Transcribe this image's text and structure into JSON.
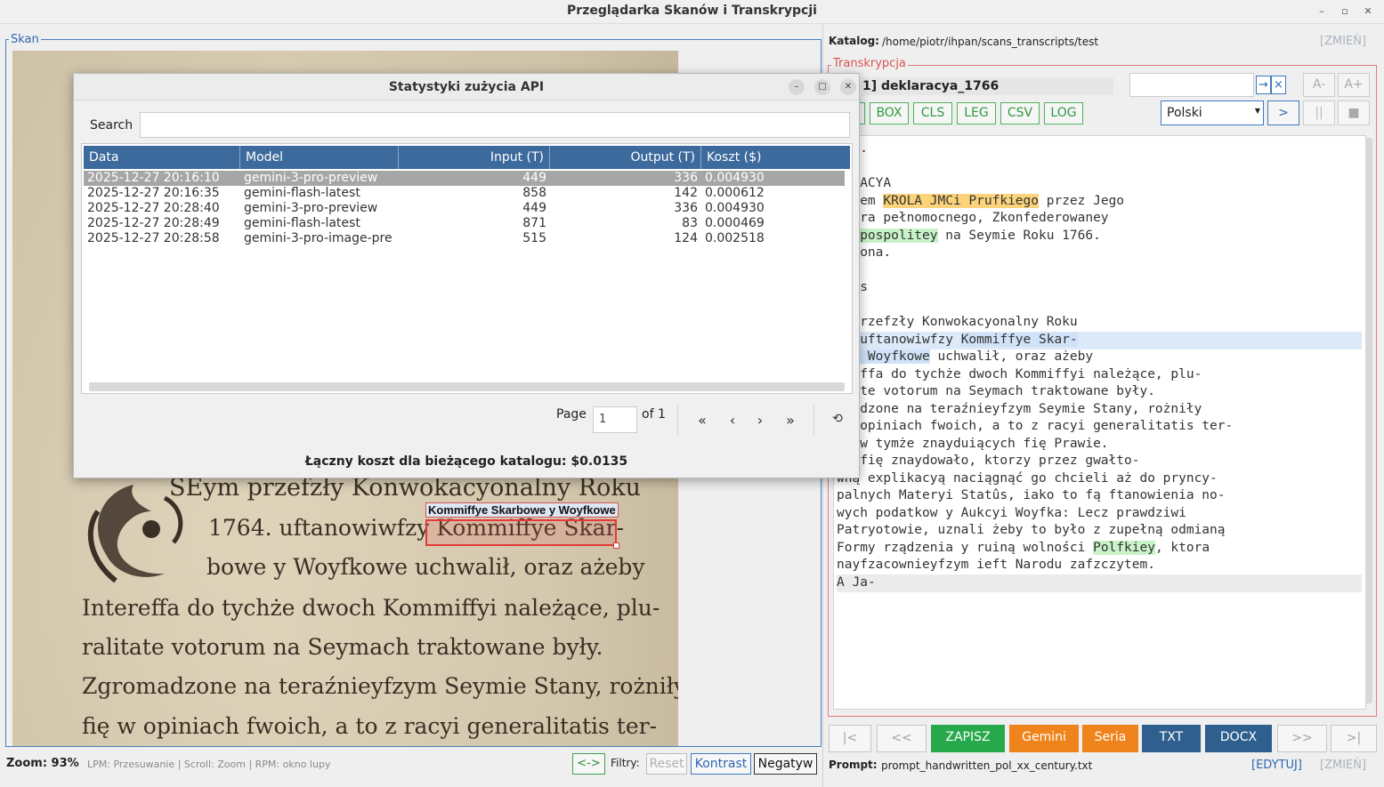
{
  "window": {
    "title": "Przeglądarka Skanów i Transkrypcji"
  },
  "left": {
    "legend": "Skan",
    "scan_lines": [
      "SEym przefzły Konwokacyonalny Roku",
      "1764. uftanowiwfzy Kommiffye Skar-",
      "bowe y Woyfkowe uchwalił, oraz ażeby",
      "Intereffa do tychże dwoch Kommiffyi należące, plu-",
      "ralitate votorum na Seymach traktowane były.",
      "Zgromadzone na teraźnieyfzym Seymie Stany, rożniły",
      "fię w opiniach fwoich, a to z racyi generalitatis ter-"
    ],
    "highlight_label": "Kommiffye Skarbowe y Woyfkowe",
    "zoom": "Zoom: 93%",
    "hint": "LPM: Przesuwanie | Scroll: Zoom | RPM: okno lupy",
    "swap": "<->",
    "filters_label": "Filtry:",
    "reset": "Reset",
    "contrast": "Kontrast",
    "negative": "Negatyw"
  },
  "dialog": {
    "title": "Statystyki zużycia API",
    "search_label": "Search",
    "columns": [
      "Data",
      "Model",
      "Input (T)",
      "Output (T)",
      "Koszt ($)"
    ],
    "rows": [
      {
        "date": "2025-12-27 20:16:10",
        "model": "gemini-3-pro-preview",
        "input": "449",
        "output": "336",
        "cost": "0.004930"
      },
      {
        "date": "2025-12-27 20:16:35",
        "model": "gemini-flash-latest",
        "input": "858",
        "output": "142",
        "cost": "0.000612"
      },
      {
        "date": "2025-12-27 20:28:40",
        "model": "gemini-3-pro-preview",
        "input": "449",
        "output": "336",
        "cost": "0.004930"
      },
      {
        "date": "2025-12-27 20:28:49",
        "model": "gemini-flash-latest",
        "input": "871",
        "output": "83",
        "cost": "0.000469"
      },
      {
        "date": "2025-12-27 20:28:58",
        "model": "gemini-3-pro-image-pre",
        "input": "515",
        "output": "124",
        "cost": "0.002518"
      }
    ],
    "page_label": "Page",
    "page_value": "1",
    "of_label": "of 1",
    "first": "«",
    "prev": "‹",
    "next": "›",
    "last": "»",
    "total": "Łączny koszt dla bieżącego katalogu: $0.0135"
  },
  "right": {
    "katalog_label": "Katalog:",
    "katalog_path": "/home/piotr/ihpan/scans_transcripts/test",
    "change": "[ZMIEŃ]",
    "legend": "Transkrypcja",
    "file_name": "1] deklaracya_1766",
    "find_next": "→",
    "find_clear": "×",
    "font_minus": "A-",
    "font_plus": "A+",
    "tools": [
      "BOX",
      "CLS",
      "LEG",
      "CSV",
      "LOG"
    ],
    "language": "Polski",
    "play": ">",
    "pause": "||",
    "stop": "■",
    "nav_first": "|<",
    "nav_prev": "<<",
    "save": "ZAPISZ",
    "gemini": "Gemini",
    "seria": "Seria",
    "txt": "TXT",
    "docx": "DOCX",
    "nav_next": ">>",
    "nav_last": ">|",
    "prompt_label": "Prompt:",
    "prompt_file": "prompt_handwritten_pol_xx_century.txt",
    "edit": "[EDYTUJ]",
    "change2": "[ZMIEŃ]"
  },
  "transcript": [
    {
      "segs": [
        {
          "t": "195."
        }
      ]
    },
    {
      "segs": [
        {
          "t": ""
        }
      ]
    },
    {
      "segs": [
        {
          "t": "LARACYA"
        }
      ]
    },
    {
      "segs": [
        {
          "t": "eniem "
        },
        {
          "t": "KROLA JMCi Prufkiego",
          "c": "hy"
        },
        {
          "t": " przez Jego"
        }
      ]
    },
    {
      "segs": [
        {
          "t": "iftra pełnomocnego, Zkonfederowaney"
        }
      ]
    },
    {
      "segs": [
        {
          "t": "czypospolitey",
          "c": "hg"
        },
        {
          "t": " na Seymie Roku 1766."
        }
      ]
    },
    {
      "segs": [
        {
          "t": "yniona."
        }
      ]
    },
    {
      "segs": [
        {
          "t": ""
        }
      ]
    },
    {
      "segs": [
        {
          "t": "ri's"
        }
      ]
    },
    {
      "segs": [
        {
          "t": ""
        }
      ]
    },
    {
      "segs": [
        {
          "t": "m przefzły Konwokacyonalny Roku"
        }
      ]
    },
    {
      "segs": [
        {
          "t": "4. uftanowiwfzy "
        },
        {
          "t": "Kommiffye Skar-",
          "c": "hb"
        }
      ]
    },
    {
      "segs": [
        {
          "t": "e y Woyfkowe",
          "c": "hb"
        },
        {
          "t": " uchwalił, oraz ażeby"
        }
      ]
    },
    {
      "segs": [
        {
          "t": "ereffa do tychże dwoch Kommiffyi należące, plu-"
        }
      ]
    },
    {
      "segs": [
        {
          "t": "itate votorum na Seymach traktowane były."
        }
      ]
    },
    {
      "segs": [
        {
          "t": "omadzone na teraźnieyfzym Seymie Stany, rożniły"
        }
      ]
    },
    {
      "segs": [
        {
          "t": " w opiniach fwoich, a to z racyi generalitatis ter-"
        }
      ]
    },
    {
      "segs": [
        {
          "t": "ow w tymże znayduiących fię Prawie."
        }
      ]
    },
    {
      "segs": [
        {
          "t": "lu fię znaydowało, ktorzy przez gwałto-"
        }
      ]
    },
    {
      "segs": [
        {
          "t": "wną explikacyą naciągnąć go chcieli aż do pryncy-"
        }
      ]
    },
    {
      "segs": [
        {
          "t": "palnych Materyi Statûs, iako to fą ftanowienia no-"
        }
      ]
    },
    {
      "segs": [
        {
          "t": "wych podatkow y Aukcyi Woyfka: Lecz prawdziwi"
        }
      ]
    },
    {
      "segs": [
        {
          "t": "Patryotowie, uznali żeby to było z zupełną odmianą"
        }
      ]
    },
    {
      "segs": [
        {
          "t": "Formy rządzenia y ruiną wolności "
        },
        {
          "t": "Polfkiey",
          "c": "hg"
        },
        {
          "t": ", ktora"
        }
      ]
    },
    {
      "segs": [
        {
          "t": "nayfzacownieyfzym ieft Narodu zafzczytem."
        }
      ]
    },
    {
      "segs": [
        {
          "t": "A Ja-"
        }
      ]
    }
  ]
}
